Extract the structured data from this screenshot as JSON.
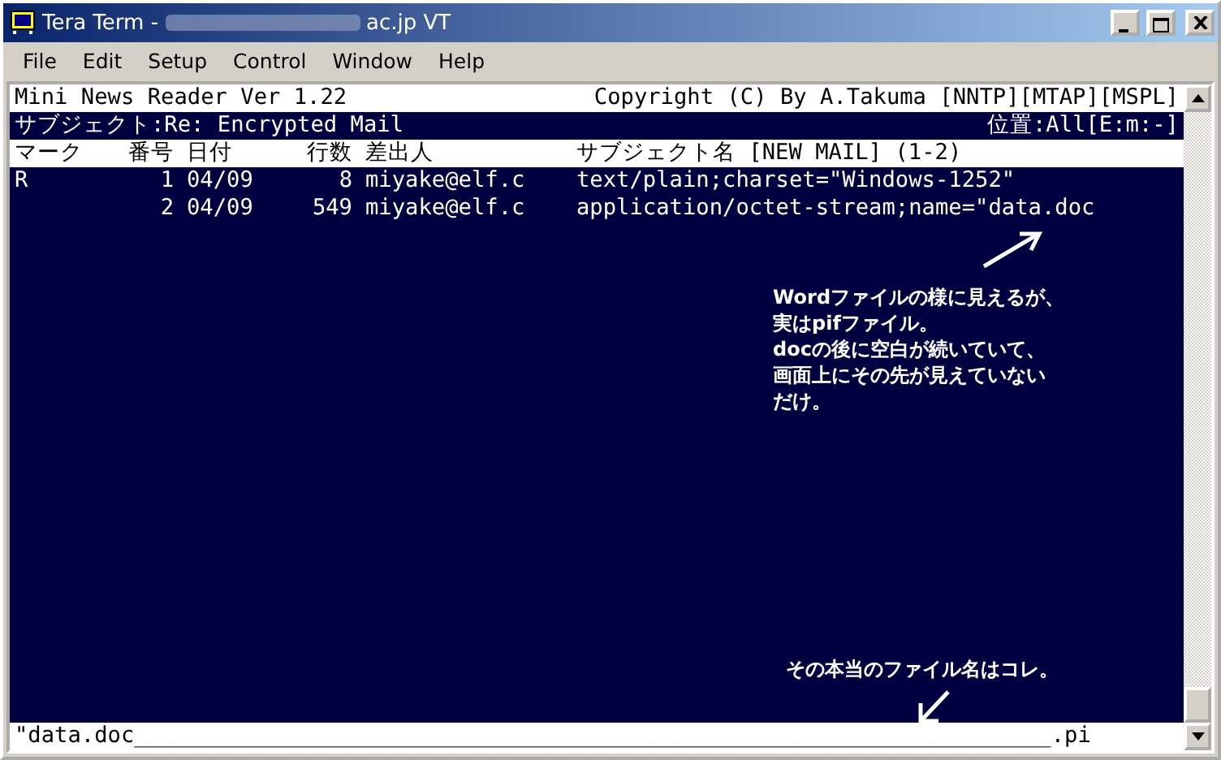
{
  "window": {
    "title_prefix": "Tera Term -",
    "title_suffix": "ac.jp VT"
  },
  "menu": [
    {
      "label": "File"
    },
    {
      "label": "Edit"
    },
    {
      "label": "Setup"
    },
    {
      "label": "Control"
    },
    {
      "label": "Window"
    },
    {
      "label": "Help"
    }
  ],
  "terminal": {
    "banner": {
      "left": "Mini News Reader Ver 1.22",
      "right": "Copyright (C) By A.Takuma [NNTP][MTAP][MSPL]"
    },
    "subject_line": {
      "left": "サブジェクト:Re: Encrypted Mail",
      "right": "位置:All[E:m:-]"
    },
    "columns": [
      "マーク",
      "番号",
      "日付",
      "行数",
      "差出人",
      "サブジェクト名 [NEW MAIL] (1-2)"
    ],
    "rows": [
      {
        "mark": "R",
        "number": "1",
        "date": "04/09",
        "lines": "8",
        "sender": "miyake@elf.c",
        "subject": "text/plain;charset=\"Windows-1252\""
      },
      {
        "number": "2",
        "date": "04/09",
        "lines": "549",
        "sender": "miyake@elf.c",
        "subject": "application/octet-stream;name=\"data.doc"
      }
    ],
    "bottom_line": "\"data.doc_____________________________________________________________________.pi"
  },
  "annotations": [
    {
      "lines": [
        "Wordファイルの様に見えるが、",
        "実はpifファイル。",
        "docの後に空白が続いていて、",
        "画面上にその先が見えていない",
        "だけ。"
      ]
    },
    {
      "lines": [
        "その本当のファイル名はコレ。"
      ]
    }
  ]
}
